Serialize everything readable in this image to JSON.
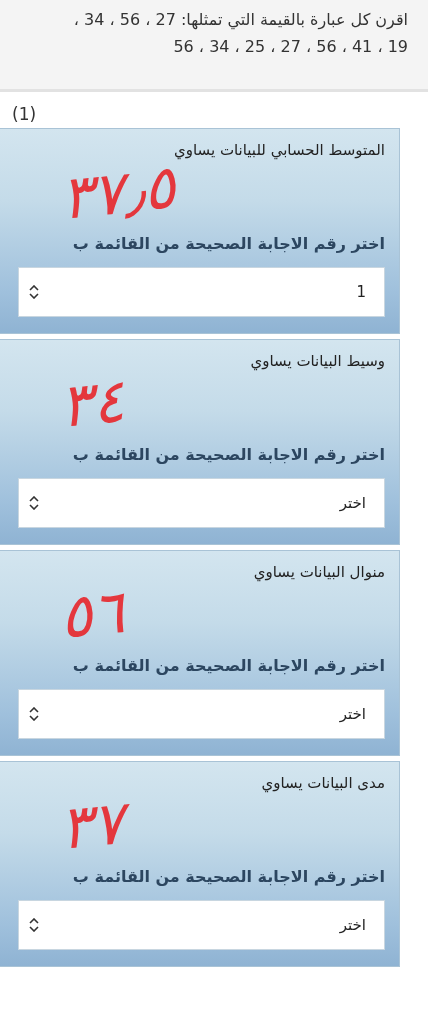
{
  "question_text": "اقرن كل عبارة بالقيمة التي تمثلها: 27 ، 56 ، 34 ، 19 ، 41 ، 56 ، 27 ، 25 ، 34 ، 56",
  "part_label": "(1)",
  "items": [
    {
      "prompt": "المتوسط الحسابي للبيانات يساوي",
      "instruction": "اختر رقم الاجابة الصحيحة من القائمة ب",
      "select_value": "1",
      "handwritten": "٣٧٫٥"
    },
    {
      "prompt": "وسيط البيانات يساوي",
      "instruction": "اختر رقم الاجابة الصحيحة من القائمة ب",
      "select_value": "اختر",
      "handwritten": "٣٤"
    },
    {
      "prompt": "منوال البيانات يساوي",
      "instruction": "اختر رقم الاجابة الصحيحة من القائمة ب",
      "select_value": "اختر",
      "handwritten": "٥٦"
    },
    {
      "prompt": "مدى البيانات يساوي",
      "instruction": "اختر رقم الاجابة الصحيحة من القائمة ب",
      "select_value": "اختر",
      "handwritten": "٣٧"
    }
  ]
}
